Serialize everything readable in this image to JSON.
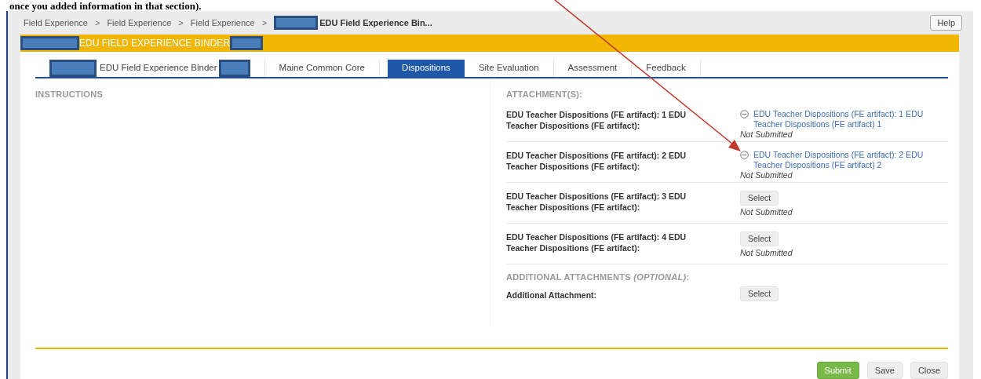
{
  "caption": "once you added information in that section).",
  "breadcrumb": [
    {
      "label": "Field Experience",
      "current": false,
      "separator": ">"
    },
    {
      "label": "Field Experience",
      "current": false,
      "separator": ">"
    },
    {
      "label": "Field Experience",
      "current": false,
      "separator": ">"
    },
    {
      "label": "EDU Field Experience Bin...",
      "current": true,
      "redacted_before": true
    }
  ],
  "help_button": "Help",
  "header": {
    "title": "EDU FIELD EXPERIENCE BINDER",
    "redacted_before": true,
    "redacted_after": true
  },
  "tabs": [
    {
      "label": "EDU Field Experience Binder",
      "selected": false,
      "redacted_before": true,
      "redacted_after": true
    },
    {
      "label": "Maine Common Core",
      "selected": false
    },
    {
      "label": "Dispositions",
      "selected": true
    },
    {
      "label": "Site Evaluation",
      "selected": false
    },
    {
      "label": "Assessment",
      "selected": false
    },
    {
      "label": "Feedback",
      "selected": false
    }
  ],
  "instructions": {
    "heading": "INSTRUCTIONS"
  },
  "attachments": {
    "heading": "ATTACHMENT(S):",
    "rows": [
      {
        "label": "EDU Teacher Dispositions (FE artifact): 1 EDU Teacher Dispositions (FE artifact):",
        "kind": "link",
        "link": "EDU Teacher Dispositions (FE artifact): 1 EDU Teacher Dispositions (FE artifact) 1",
        "status": "Not Submitted"
      },
      {
        "label": "EDU Teacher Dispositions (FE artifact): 2 EDU Teacher Dispositions (FE artifact):",
        "kind": "link",
        "link": "EDU Teacher Dispositions (FE artifact): 2 EDU Teacher Dispositions (FE artifact) 2",
        "status": "Not Submitted"
      },
      {
        "label": "EDU Teacher Dispositions (FE artifact): 3 EDU Teacher Dispositions (FE artifact):",
        "kind": "select",
        "button": "Select",
        "status": "Not Submitted"
      },
      {
        "label": "EDU Teacher Dispositions (FE artifact): 4 EDU Teacher Dispositions (FE artifact):",
        "kind": "select",
        "button": "Select",
        "status": "Not Submitted"
      }
    ]
  },
  "additional": {
    "heading": "ADDITIONAL ATTACHMENTS *(OPTIONAL)*:",
    "rows": [
      {
        "label": "Additional Attachment:",
        "kind": "select",
        "button": "Select"
      }
    ]
  },
  "footer_buttons": [
    {
      "label": "Submit",
      "kind": "primary"
    },
    {
      "label": "Save",
      "kind": "default"
    },
    {
      "label": "Close",
      "kind": "default"
    }
  ]
}
